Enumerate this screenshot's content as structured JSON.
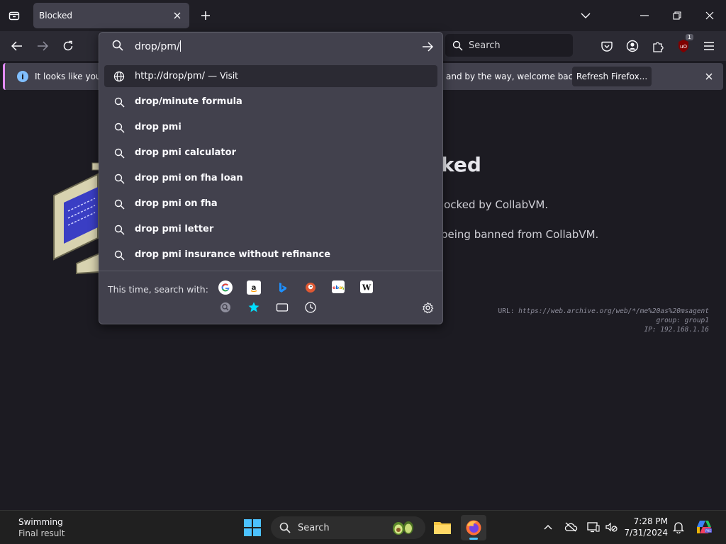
{
  "tabs": [
    {
      "title": "Blocked"
    }
  ],
  "toolbar": {
    "search_placeholder": "Search",
    "extension_badge": "1"
  },
  "notification": {
    "message_left": "It looks like you ha",
    "message_right": "and by the way, welcome back!",
    "button_label": "Refresh Firefox..."
  },
  "urlbar": {
    "value": "drop/pm/",
    "visit_url": "http://drop/pm/",
    "visit_sep": " — ",
    "visit_label": "Visit",
    "suggestions": [
      "drop/minute formula",
      "drop pmi",
      "drop pmi calculator",
      "drop pmi on fha loan",
      "drop pmi on fha",
      "drop pmi letter",
      "drop pmi insurance without refinance"
    ],
    "engines_label": "This time, search with:"
  },
  "page": {
    "heading": "ked",
    "line1": "locked by CollabVM.",
    "line2": "being banned from CollabVM.",
    "diag_url_label": "URL:",
    "diag_url": "https://web.archive.org/web/*/me%20as%20msagent",
    "diag_group": "group: group1",
    "diag_ip": "IP: 192.168.1.16"
  },
  "taskbar": {
    "weather_title": "Swimming",
    "weather_sub": "Final result",
    "search_label": "Search",
    "time": "7:28 PM",
    "date": "7/31/2024"
  },
  "colors": {
    "accent": "#4cc2ff",
    "notif_stripe": "#e38cfc"
  }
}
